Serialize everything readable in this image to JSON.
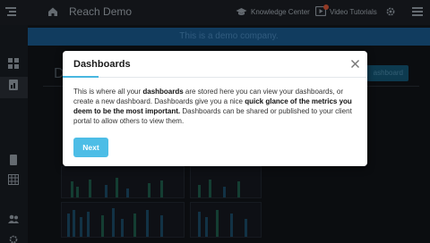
{
  "header": {
    "app_title": "Reach Demo",
    "knowledge_center_label": "Knowledge Center",
    "video_tutorials_label": "Video Tutorials"
  },
  "banner": {
    "text": "This is a demo company."
  },
  "background": {
    "page_title_fragment": "D",
    "add_button_fragment": "ashboard"
  },
  "modal": {
    "title": "Dashboards",
    "body_1": "This is where all your ",
    "body_bold_1": "dashboards",
    "body_2": " are stored here you can view your dashboards, or create a new dashboard. Dashboards give you a nice ",
    "body_bold_2": "quick glance of the metrics you deem to be the most important.",
    "body_3": " Dashboards can be shared or published to your client portal to allow others to view them.",
    "next_label": "Next"
  },
  "colors": {
    "accent": "#48b6e0",
    "banner": "#1b5d93",
    "primary_button": "#4dbde6"
  }
}
